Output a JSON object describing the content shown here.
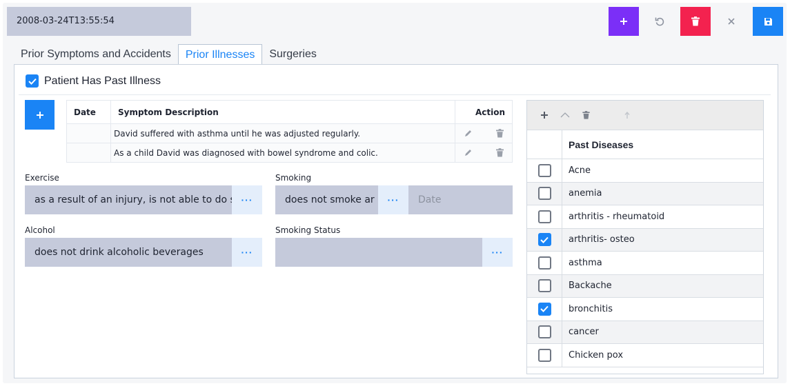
{
  "header": {
    "datetime": "2008-03-24T13:55:54",
    "buttons": {
      "add": "plus-icon",
      "undo": "undo-icon",
      "delete": "trash-icon",
      "close": "close-icon",
      "save": "save-icon"
    }
  },
  "tabs": [
    {
      "label": "Prior Symptoms and Accidents",
      "active": false
    },
    {
      "label": "Prior Illnesses",
      "active": true
    },
    {
      "label": "Surgeries",
      "active": false
    }
  ],
  "past_illness": {
    "label": "Patient Has Past Illness",
    "checked": true
  },
  "symptoms_table": {
    "columns": [
      "Date",
      "Symptom Description",
      "Action"
    ],
    "rows": [
      {
        "date": "",
        "description": "David suffered with asthma until he was adjusted regularly."
      },
      {
        "date": "",
        "description": "As a child David was diagnosed with bowel syndrome and colic."
      }
    ]
  },
  "fields": {
    "exercise": {
      "label": "Exercise",
      "value": "as a result of an injury, is not able to do s"
    },
    "smoking": {
      "label": "Smoking",
      "value": "does not smoke ar",
      "date_placeholder": "Date"
    },
    "alcohol": {
      "label": "Alcohol",
      "value": "does not drink alcoholic beverages"
    },
    "smoking_status": {
      "label": "Smoking Status",
      "value": ""
    }
  },
  "diseases": {
    "title": "Past Diseases",
    "toolbar": [
      "plus-icon",
      "chevron-up-icon",
      "trash-icon",
      "arrow-up-icon"
    ],
    "items": [
      {
        "name": "Acne",
        "checked": false
      },
      {
        "name": "anemia",
        "checked": false
      },
      {
        "name": "arthritis - rheumatoid",
        "checked": false
      },
      {
        "name": "arthritis- osteo",
        "checked": true
      },
      {
        "name": "asthma",
        "checked": false
      },
      {
        "name": "Backache",
        "checked": false
      },
      {
        "name": "bronchitis",
        "checked": true
      },
      {
        "name": "cancer",
        "checked": false
      },
      {
        "name": "Chicken pox",
        "checked": false
      }
    ]
  },
  "colors": {
    "primary": "#1a84f5",
    "purple": "#7b2ff7",
    "danger": "#f3224f",
    "field_bg": "#c5cadb"
  }
}
